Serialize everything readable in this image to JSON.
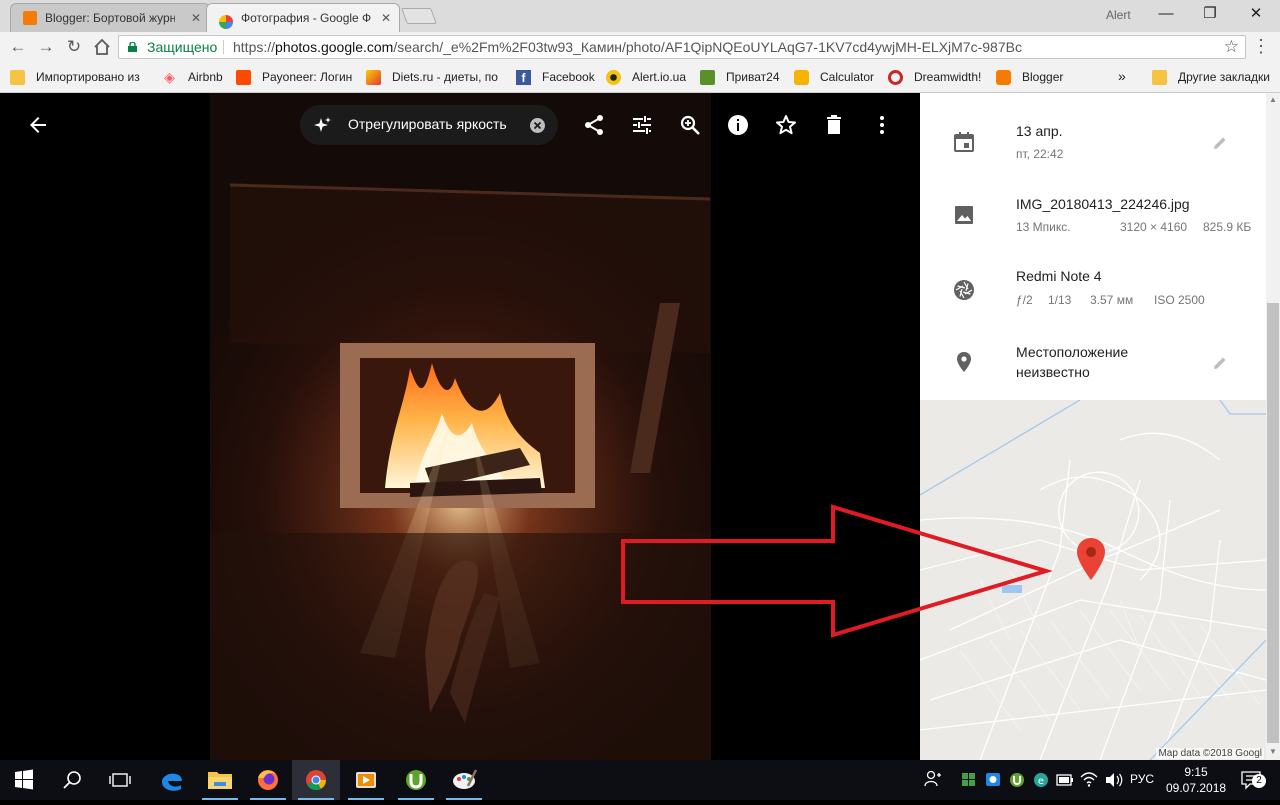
{
  "browser": {
    "tabs": [
      {
        "title": "Blogger: Бортовой журн",
        "active": false,
        "favicon": "blogger-icon",
        "color": "#f57c00"
      },
      {
        "title": "Фотография - Google Фо",
        "active": true,
        "favicon": "google-photos-icon",
        "color": "#4285f4"
      }
    ],
    "profile_name": "Alert",
    "secure_label": "Защищено",
    "url_prefix": "https://",
    "url_host": "photos.google.com",
    "url_path": "/search/_e%2Fm%2F03tw93_Камин/photo/AF1QipNQEoUYLAqG7-1KV7cd4ywjMH-ELXjM7c-987Bc",
    "bookmarks": [
      {
        "label": "Импортировано из",
        "icon": "folder-icon"
      },
      {
        "label": "Airbnb",
        "icon": "airbnb-icon"
      },
      {
        "label": "Payoneer: Логин",
        "icon": "payoneer-icon"
      },
      {
        "label": "Diets.ru - диеты, по",
        "icon": "diets-icon"
      },
      {
        "label": "Facebook",
        "icon": "facebook-icon"
      },
      {
        "label": "Alert.io.ua",
        "icon": "alert-icon"
      },
      {
        "label": "Приват24",
        "icon": "privat24-icon"
      },
      {
        "label": "Calculator",
        "icon": "calculator-icon"
      },
      {
        "label": "Dreamwidth!",
        "icon": "dreamwidth-icon"
      },
      {
        "label": "Blogger",
        "icon": "blogger-icon"
      }
    ],
    "bookmarks_more": "»",
    "other_bookmarks": "Другие закладки"
  },
  "viewer": {
    "adjust_label": "Отрегулировать яркость",
    "actions": [
      "back-icon",
      "share-icon",
      "edit-icon",
      "zoom-icon",
      "info-icon",
      "star-icon",
      "delete-icon",
      "more-icon"
    ]
  },
  "info": {
    "date": {
      "primary": "13 апр.",
      "secondary": "пт, 22:42"
    },
    "file": {
      "name": "IMG_20180413_224246.jpg",
      "megapixels": "13 Мпикс.",
      "resolution": "3120 × 4160",
      "size": "825.9 КБ"
    },
    "camera": {
      "model": "Redmi Note 4",
      "aperture": "ƒ/2",
      "shutter": "1/13",
      "focal": "3.57 мм",
      "iso": "ISO 2500"
    },
    "location": {
      "line1": "Местоположение",
      "line2": "неизвестно"
    }
  },
  "map": {
    "attribution": "Map data ©2018 Googl",
    "pin_color": "#ea4335"
  },
  "annotation": {
    "arrow_color": "#e01b24"
  },
  "taskbar": {
    "apps": [
      "windows-start-icon",
      "search-icon",
      "task-view-icon",
      "edge-icon",
      "file-explorer-icon",
      "firefox-icon",
      "chrome-icon",
      "media-player-icon",
      "utorrent-icon",
      "paint-icon"
    ],
    "language": "РУС",
    "time": "9:15",
    "date": "09.07.2018",
    "notifications": "2"
  }
}
